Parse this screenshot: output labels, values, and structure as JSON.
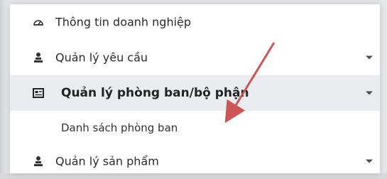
{
  "menu": {
    "items": [
      {
        "label": "Thông tin doanh nghiệp",
        "icon": "speedometer-icon",
        "has_caret": false
      },
      {
        "label": "Quản lý yêu cầu",
        "icon": "user-stack-icon",
        "has_caret": true
      },
      {
        "label": "Quản lý phòng ban/bộ phận",
        "icon": "id-card-icon",
        "has_caret": true,
        "active": true
      },
      {
        "label": "Danh sách phòng ban",
        "icon": "",
        "has_caret": false,
        "submenu": true
      },
      {
        "label": "Quản lý sản phẩm",
        "icon": "user-stack-icon",
        "has_caret": true
      }
    ]
  },
  "colors": {
    "active_row_bg": "#eaecef",
    "annotation_arrow": "#cc5656"
  }
}
